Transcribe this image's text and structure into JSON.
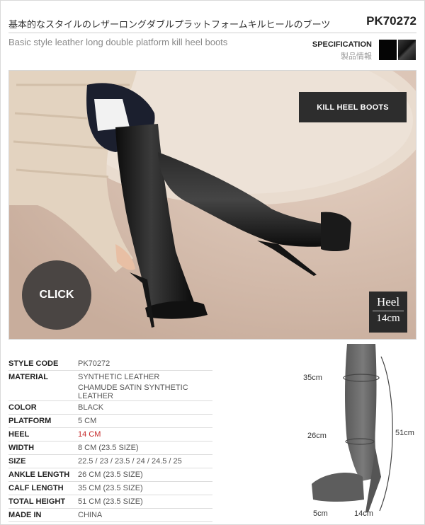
{
  "header": {
    "title_jp": "基本的なスタイルのレザーロングダブルプラットフォームキルヒールのブーツ",
    "product_code": "PK70272",
    "title_en": "Basic style leather long double platform kill heel boots"
  },
  "specification": {
    "label_en": "SPECIFICATION",
    "label_jp": "製品情報",
    "swatches": [
      "#050505",
      "#2a2a2a"
    ]
  },
  "photo": {
    "badge": "KILL HEEL BOOTS",
    "click_label": "CLICK",
    "heel_label": "Heel",
    "heel_value": "14cm"
  },
  "specs": [
    {
      "key": "STYLE CODE",
      "value": "PK70272"
    },
    {
      "key": "MATERIAL",
      "value": "SYNTHETIC LEATHER",
      "value2": "CHAMUDE SATIN SYNTHETIC LEATHER"
    },
    {
      "key": "COLOR",
      "value": "BLACK"
    },
    {
      "key": "PLATFORM",
      "value": "5 CM"
    },
    {
      "key": "HEEL",
      "value": "14 CM",
      "highlight": "#c62828"
    },
    {
      "key": "WIDTH",
      "value": "8 CM (23.5 SIZE)"
    },
    {
      "key": "SIZE",
      "value": "22.5 / 23 / 23.5 / 24 / 24.5 / 25"
    },
    {
      "key": "ANKLE LENGTH",
      "value": "26 CM (23.5 SIZE)"
    },
    {
      "key": "CALF LENGTH",
      "value": "35 CM (23.5 SIZE)"
    },
    {
      "key": "TOTAL HEIGHT",
      "value": "51 CM (23.5 SIZE)"
    },
    {
      "key": "MADE IN",
      "value": "CHINA"
    }
  ],
  "diagram": {
    "calf": "35cm",
    "ankle": "26cm",
    "height": "51cm",
    "platform": "5cm",
    "heel": "14cm"
  }
}
